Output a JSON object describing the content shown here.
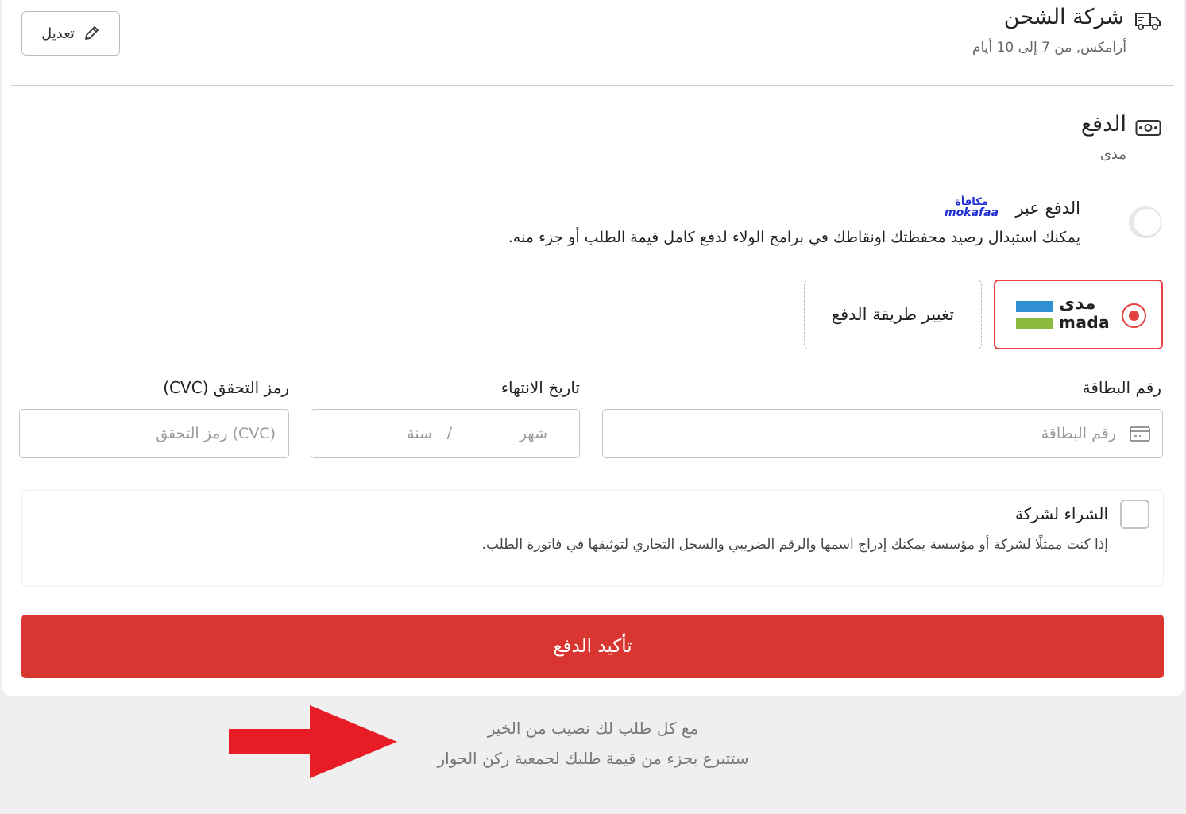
{
  "shipping": {
    "title": "شركة الشحن",
    "subtitle": "أرامكس, من 7 إلى 10 أيام",
    "edit_label": "تعديل",
    "icon": "truck-icon"
  },
  "payment": {
    "title": "الدفع",
    "subtitle": "مدى",
    "icon": "money-icon",
    "mokafaa": {
      "label": "الدفع عبر",
      "logo_ar": "مكافأة",
      "logo_en": "mokafaa",
      "description": "يمكنك استبدال رصيد محفظتك اونقاطك في برامج الولاء لدفع كامل قيمة الطلب أو جزء منه.",
      "toggle_on": false
    },
    "methods": {
      "selected_ar": "مدى",
      "selected_en": "mada",
      "change_label": "تغيير طريقة الدفع"
    },
    "fields": {
      "card_label": "رقم البطاقة",
      "card_placeholder": "رقم البطاقة",
      "expiry_label": "تاريخ الانتهاء",
      "month_placeholder": "شهر",
      "separator": "/",
      "year_placeholder": "سنة",
      "cvc_label": "رمز التحقق (CVC)",
      "cvc_placeholder": "(CVC) رمز التحقق"
    },
    "company": {
      "title": "الشراء لشركة",
      "description": "إذا كنت ممثلًا لشركة أو مؤسسة يمكنك إدراج اسمها والرقم الضريبي والسجل التجاري لتوثيقها في فاتورة الطلب.",
      "checked": false
    },
    "confirm_label": "تأكيد الدفع"
  },
  "footer": {
    "line1": "مع كل طلب لك نصيب من الخير",
    "line2": "ستتبرع بجزء من قيمة طلبك لجمعية ركن الحوار"
  },
  "colors": {
    "accent": "#d93632",
    "selected_border": "#e64141",
    "mokafaa_blue": "#1f2fd0",
    "mada_blue": "#2f8fd0",
    "mada_green": "#8bbb3a",
    "annotation_arrow": "#e81c24"
  }
}
